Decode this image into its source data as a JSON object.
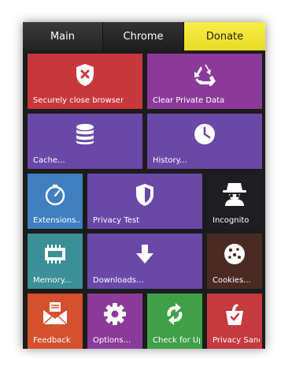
{
  "tabs": {
    "main": "Main",
    "chrome": "Chrome",
    "donate": "Donate"
  },
  "tiles": {
    "securely_close": "Securely close browser",
    "clear_private": "Clear Private Data",
    "cache": "Cache...",
    "history": "History...",
    "extensions": "Extensions..",
    "privacy_test": "Privacy Test",
    "incognito": "Incognito",
    "memory": "Memory...",
    "downloads": "Downloads...",
    "cookies": "Cookies...",
    "feedback": "Feedback",
    "options": "Options...",
    "check_updates": "Check for Updates",
    "privacy_sandbox": "Privacy Sandbox"
  },
  "colors": {
    "red": "#c8373c",
    "magenta": "#8b3a9a",
    "purple": "#6a48a8",
    "blue": "#3f7fc0",
    "dark": "#1e1e22",
    "teal": "#3b8f96",
    "brown": "#4a2a22",
    "orange": "#d4502e",
    "green": "#3fa048",
    "crimson": "#c43a3f",
    "donate": "#f4e73a"
  }
}
